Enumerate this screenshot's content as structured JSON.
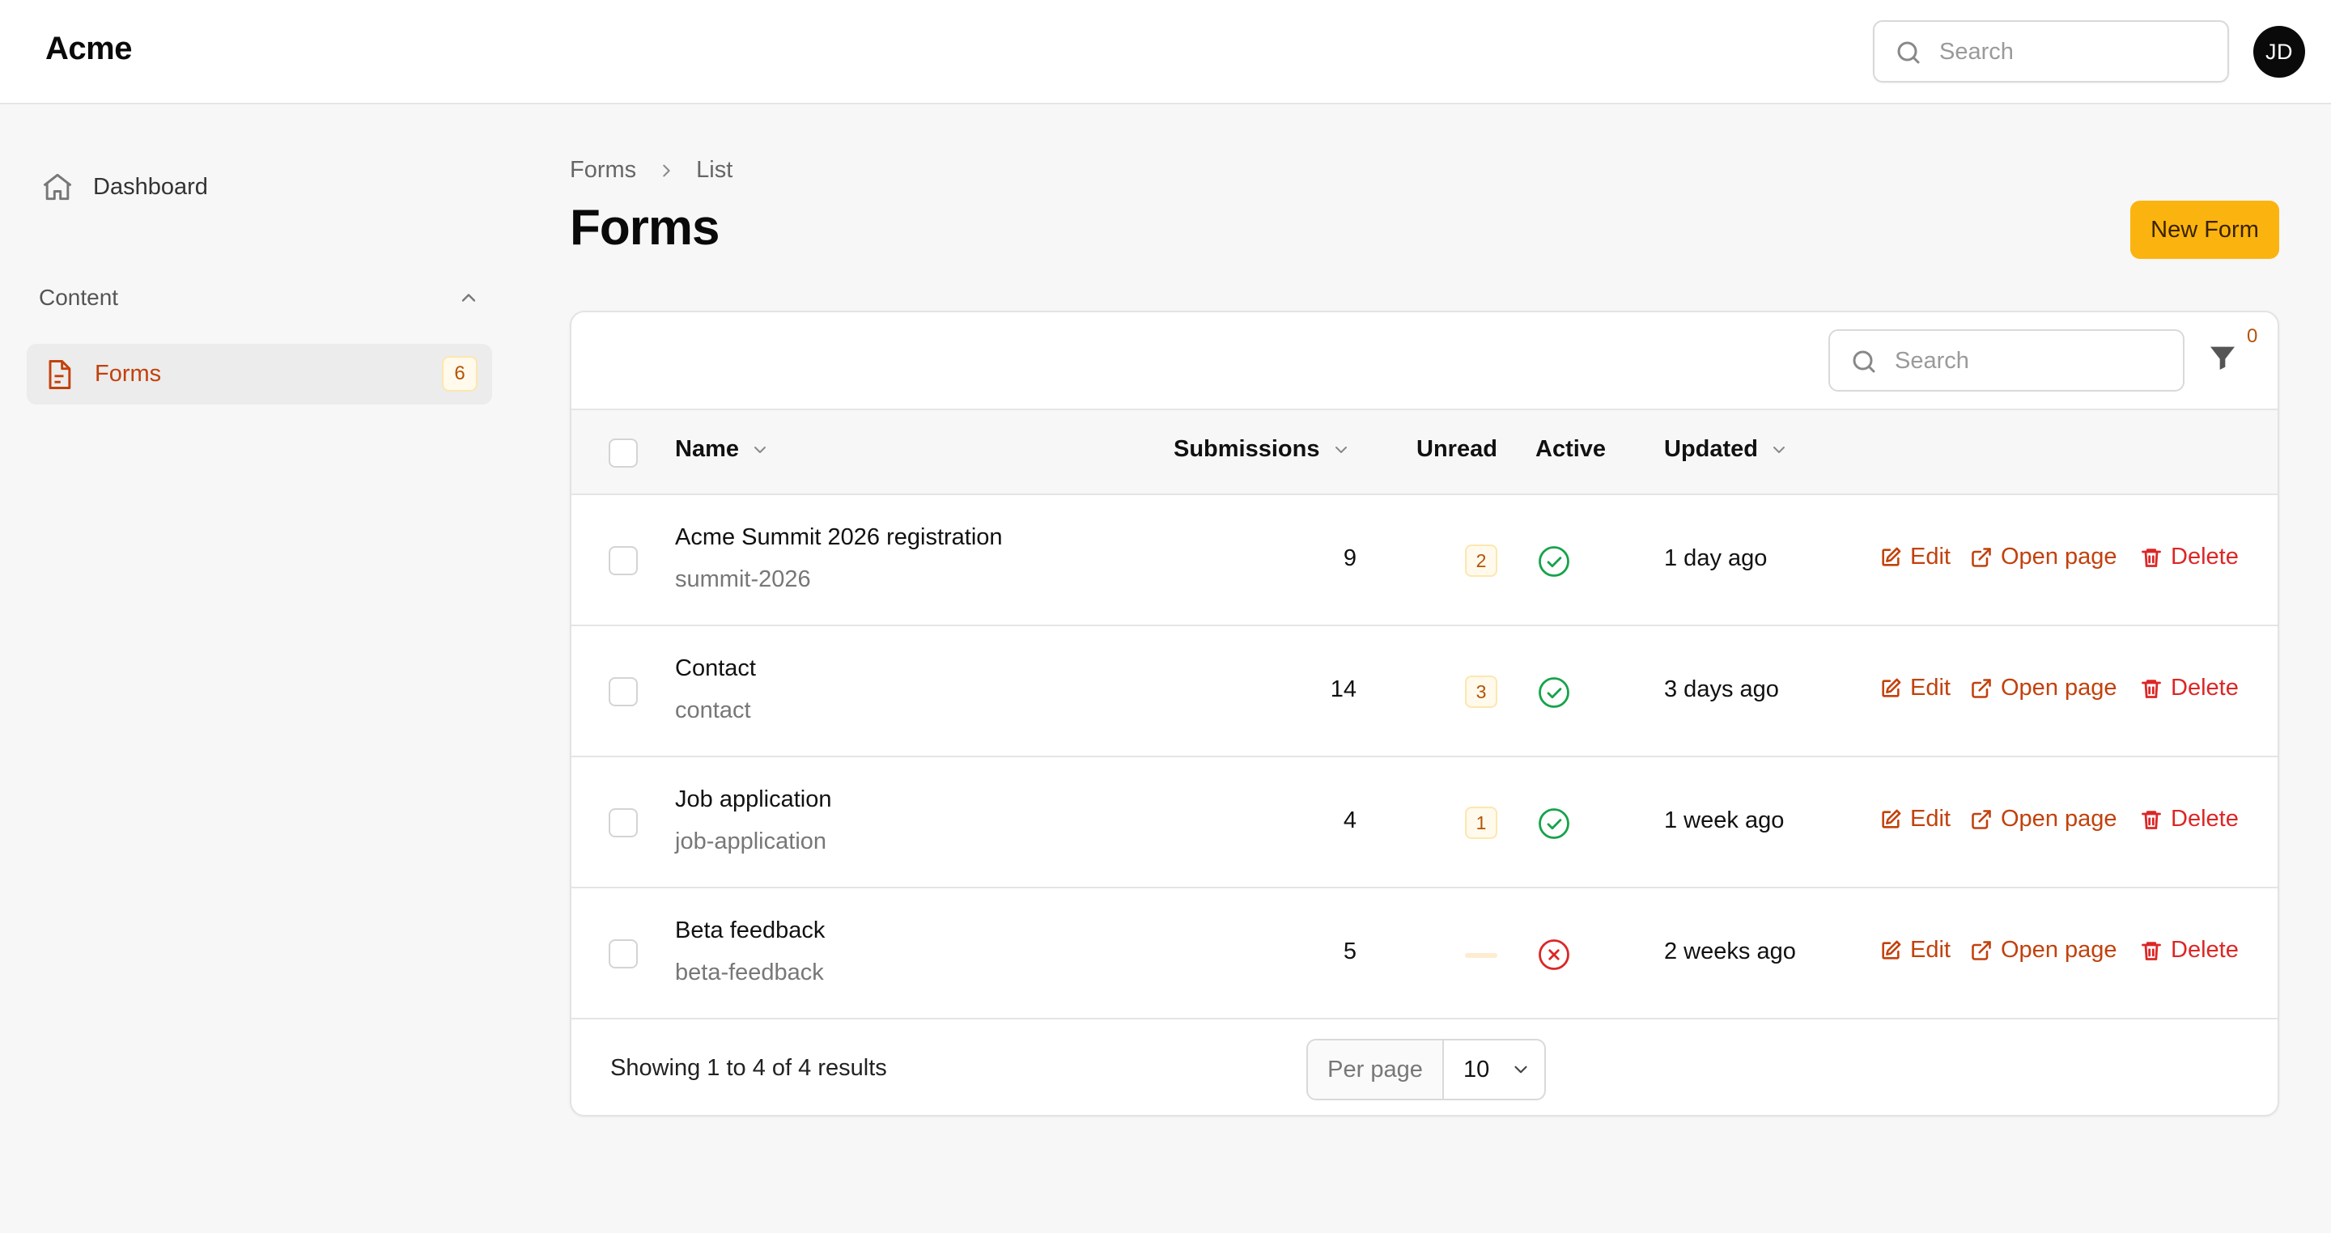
{
  "app": {
    "brand": "Acme",
    "avatar_initials": "JD"
  },
  "search": {
    "placeholder": "Search"
  },
  "sidebar": {
    "dashboard_label": "Dashboard",
    "group_label": "Content",
    "items": [
      {
        "label": "Forms",
        "badge": "6",
        "active": true
      }
    ]
  },
  "page": {
    "breadcrumb": [
      "Forms",
      "List"
    ],
    "title": "Forms",
    "new_button": "New Form"
  },
  "table": {
    "search_placeholder": "Search",
    "filter_count": "0",
    "columns": {
      "name": "Name",
      "submissions": "Submissions",
      "unread": "Unread",
      "active": "Active",
      "updated": "Updated"
    },
    "actions": {
      "edit": "Edit",
      "open": "Open page",
      "delete": "Delete"
    },
    "rows": [
      {
        "name": "Acme Summit 2026 registration",
        "slug": "summit-2026",
        "submissions": "9",
        "unread": "2",
        "active": true,
        "updated": "1 day ago"
      },
      {
        "name": "Contact",
        "slug": "contact",
        "submissions": "14",
        "unread": "3",
        "active": true,
        "updated": "3 days ago"
      },
      {
        "name": "Job application",
        "slug": "job-application",
        "submissions": "4",
        "unread": "1",
        "active": true,
        "updated": "1 week ago"
      },
      {
        "name": "Beta feedback",
        "slug": "beta-feedback",
        "submissions": "5",
        "unread": "",
        "active": false,
        "updated": "2 weeks ago"
      }
    ],
    "footer": {
      "summary": "Showing 1 to 4 of 4 results",
      "per_page_label": "Per page",
      "per_page_value": "10"
    }
  },
  "colors": {
    "accent": "#fbb40f",
    "link": "#c2410c",
    "danger": "#dc2626",
    "success": "#16a34a"
  },
  "icons": [
    "search-icon",
    "home-icon",
    "chevron-up-icon",
    "document-icon",
    "chevron-right-icon",
    "filter-icon",
    "chevron-down-icon",
    "check-circle-icon",
    "x-circle-icon",
    "edit-icon",
    "external-link-icon",
    "trash-icon"
  ]
}
